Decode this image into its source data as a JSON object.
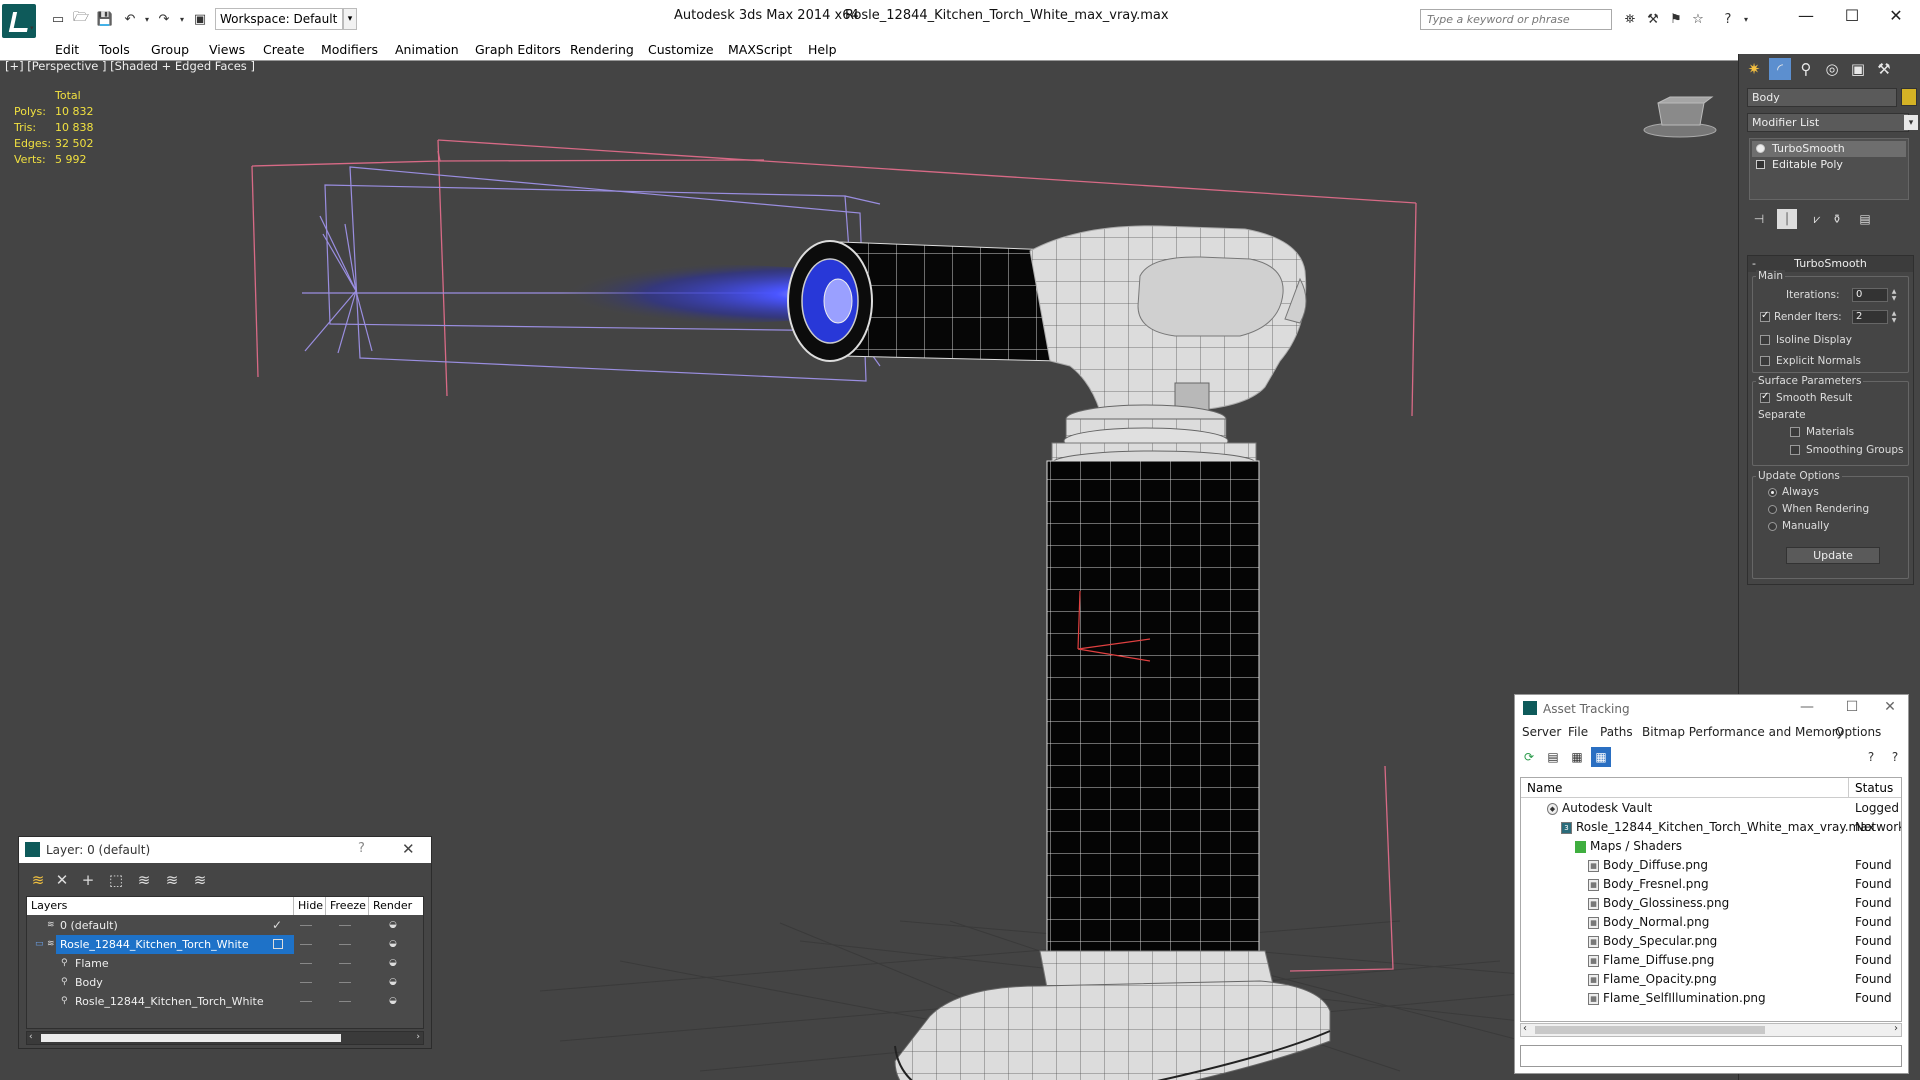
{
  "titlebar": {
    "workspace": "Workspace: Default",
    "app_name": "Autodesk 3ds Max  2014 x64",
    "file_name": "Rosle_12844_Kitchen_Torch_White_max_vray.max",
    "search_placeholder": "Type a keyword or phrase"
  },
  "menu": [
    "Edit",
    "Tools",
    "Group",
    "Views",
    "Create",
    "Modifiers",
    "Animation",
    "Graph Editors",
    "Rendering",
    "Customize",
    "MAXScript",
    "Help"
  ],
  "viewport": {
    "label": "[+] [Perspective ] [Shaded + Edged Faces ]",
    "stats": {
      "header": "Total",
      "rows": [
        {
          "label": "Polys:",
          "value": "10 832"
        },
        {
          "label": "Tris:",
          "value": "10 838"
        },
        {
          "label": "Edges:",
          "value": "32 502"
        },
        {
          "label": "Verts:",
          "value": "5 992"
        }
      ]
    }
  },
  "command_panel": {
    "object_name": "Body",
    "object_color": "#d4b225",
    "modifier_list": "Modifier List",
    "stack": [
      "TurboSmooth",
      "Editable Poly"
    ],
    "turbosmooth": {
      "title": "TurboSmooth",
      "main_label": "Main",
      "iterations_label": "Iterations:",
      "iterations_value": "0",
      "render_iters_label": "Render Iters:",
      "render_iters_value": "2",
      "isoline": "Isoline Display",
      "explicit_normals": "Explicit Normals",
      "surface_label": "Surface Parameters",
      "smooth_result": "Smooth Result",
      "separate_label": "Separate",
      "materials": "Materials",
      "smoothing_groups": "Smoothing Groups",
      "update_label": "Update Options",
      "always": "Always",
      "when_rendering": "When Rendering",
      "manually": "Manually",
      "update_button": "Update"
    }
  },
  "layer_dialog": {
    "title": "Layer: 0 (default)",
    "help": "?",
    "columns": [
      "Layers",
      "Hide",
      "Freeze",
      "Render"
    ],
    "rows": [
      {
        "name": "0 (default)"
      },
      {
        "name": "Rosle_12844_Kitchen_Torch_White"
      },
      {
        "name": "Flame"
      },
      {
        "name": "Body"
      },
      {
        "name": "Rosle_12844_Kitchen_Torch_White"
      }
    ]
  },
  "asset_tracking": {
    "title": "Asset Tracking",
    "menu": [
      "Server",
      "File",
      "Paths",
      "Bitmap Performance and Memory",
      "Options"
    ],
    "columns": [
      "Name",
      "Status"
    ],
    "rows": [
      {
        "name": "Autodesk Vault",
        "status": "Logged O"
      },
      {
        "name": "Rosle_12844_Kitchen_Torch_White_max_vray.max",
        "status": "Network F"
      },
      {
        "name": "Maps / Shaders",
        "status": ""
      },
      {
        "name": "Body_Diffuse.png",
        "status": "Found"
      },
      {
        "name": "Body_Fresnel.png",
        "status": "Found"
      },
      {
        "name": "Body_Glossiness.png",
        "status": "Found"
      },
      {
        "name": "Body_Normal.png",
        "status": "Found"
      },
      {
        "name": "Body_Specular.png",
        "status": "Found"
      },
      {
        "name": "Flame_Diffuse.png",
        "status": "Found"
      },
      {
        "name": "Flame_Opacity.png",
        "status": "Found"
      },
      {
        "name": "Flame_SelfIllumination.png",
        "status": "Found"
      }
    ]
  }
}
